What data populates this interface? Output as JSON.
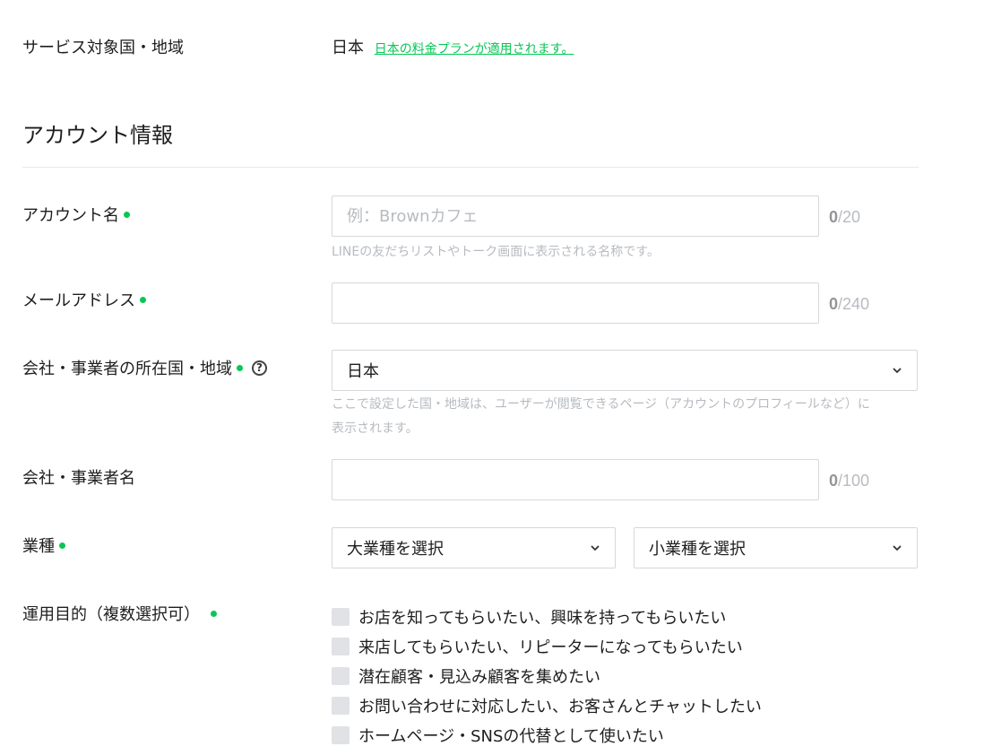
{
  "service_country": {
    "label": "サービス対象国・地域",
    "value": "日本",
    "link": "日本の料金プランが適用されます。"
  },
  "section": {
    "title": "アカウント情報"
  },
  "account_name": {
    "label": "アカウント名",
    "placeholder": "例：Brownカフェ",
    "value": "",
    "count": "0",
    "max": "/20",
    "hint": "LINEの友だちリストやトーク画面に表示される名称です。"
  },
  "email": {
    "label": "メールアドレス",
    "value": "",
    "count": "0",
    "max": "/240"
  },
  "company_country": {
    "label": "会社・事業者の所在国・地域",
    "selected": "日本",
    "hint_line1": "ここで設定した国・地域は、ユーザーが閲覧できるページ（アカウントのプロフィールなど）に",
    "hint_line2": "表示されます。"
  },
  "company_name": {
    "label": "会社・事業者名",
    "value": "",
    "count": "0",
    "max": "/100"
  },
  "industry": {
    "label": "業種",
    "major_placeholder": "大業種を選択",
    "minor_placeholder": "小業種を選択"
  },
  "purpose": {
    "label": "運用目的（複数選択可）",
    "options": [
      {
        "label": "お店を知ってもらいたい、興味を持ってもらいたい",
        "checked": false
      },
      {
        "label": "来店してもらいたい、リピーターになってもらいたい",
        "checked": false
      },
      {
        "label": "潜在顧客・見込み顧客を集めたい",
        "checked": false
      },
      {
        "label": "お問い合わせに対応したい、お客さんとチャットしたい",
        "checked": false
      },
      {
        "label": "ホームページ・SNSの代替として使いたい",
        "checked": false
      }
    ]
  },
  "colors": {
    "accent": "#06c755",
    "border": "#d5d8dc",
    "muted": "#b7bbc0"
  },
  "icons": {
    "required": "required-dot-icon",
    "help": "question-circle-icon",
    "dropdown": "chevron-down-icon",
    "checkbox": "checkbox-icon"
  }
}
